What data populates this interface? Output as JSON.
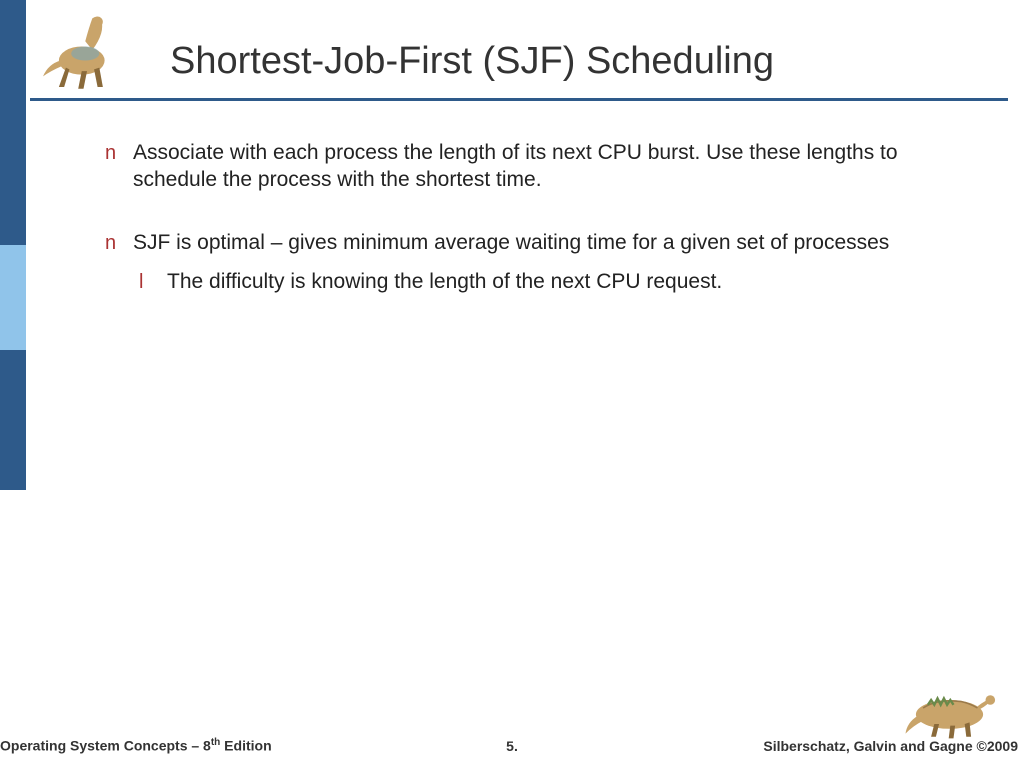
{
  "title": "Shortest-Job-First (SJF) Scheduling",
  "bullets": [
    {
      "marker": "n",
      "text": "Associate with each process the length of its next CPU burst.  Use these lengths to schedule the process with the shortest time."
    },
    {
      "marker": "n",
      "text": "SJF is optimal – gives minimum average waiting time for a given set of processes",
      "sub": {
        "marker": "l",
        "text": "The difficulty is knowing the length of the next CPU request."
      }
    }
  ],
  "footer": {
    "left_a": "Operating System Concepts – 8",
    "left_sup": "th",
    "left_b": " Edition",
    "center": "5.",
    "right": "Silberschatz, Galvin and Gagne ©2009"
  }
}
